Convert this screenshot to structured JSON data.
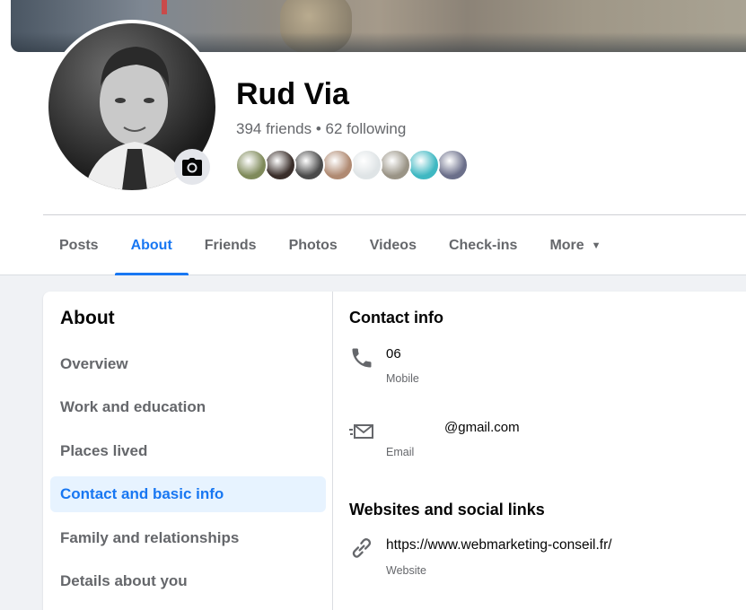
{
  "profile": {
    "name": "Rud Via",
    "friends_line": "394 friends • 62 following",
    "friend_avatar_colors": [
      "#7f8a5a",
      "#3a2e2a",
      "#4b4b4b",
      "#b08a72",
      "#dfe4e6",
      "#9a9486",
      "#3fb8c2",
      "#6b6f8a"
    ]
  },
  "tabs": [
    {
      "label": "Posts",
      "active": false
    },
    {
      "label": "About",
      "active": true
    },
    {
      "label": "Friends",
      "active": false
    },
    {
      "label": "Photos",
      "active": false
    },
    {
      "label": "Videos",
      "active": false
    },
    {
      "label": "Check-ins",
      "active": false
    },
    {
      "label": "More",
      "active": false
    }
  ],
  "about": {
    "title": "About",
    "menu": [
      {
        "label": "Overview"
      },
      {
        "label": "Work and education"
      },
      {
        "label": "Places lived"
      },
      {
        "label": "Contact and basic info"
      },
      {
        "label": "Family and relationships"
      },
      {
        "label": "Details about you"
      }
    ],
    "active_menu_index": 3
  },
  "contact": {
    "title": "Contact info",
    "phone_value": "06",
    "phone_label": "Mobile",
    "email_value": "@gmail.com",
    "email_label": "Email"
  },
  "websites": {
    "title": "Websites and social links",
    "url": "https://www.webmarketing-conseil.fr/",
    "url_label": "Website"
  },
  "icons": {
    "camera": "camera-icon",
    "phone": "phone-icon",
    "email": "email-icon",
    "link": "link-icon",
    "caret": "caret-down-icon"
  },
  "colors": {
    "accent": "#1877f2",
    "active_bg": "#e7f3ff",
    "secondary_text": "#65676b",
    "page_bg": "#f0f2f5"
  }
}
